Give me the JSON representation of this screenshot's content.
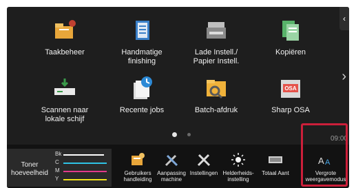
{
  "apps": [
    {
      "label": "Taakbeheer",
      "icon": "job-status-icon"
    },
    {
      "label": "Handmatige finishing",
      "icon": "manual-finishing-icon"
    },
    {
      "label": "Lade Instell./ Papier Instell.",
      "icon": "tray-settings-icon"
    },
    {
      "label": "Kopiëren",
      "icon": "copy-icon"
    },
    {
      "label": "Scannen naar lokale schijf",
      "icon": "scan-to-local-drive-icon"
    },
    {
      "label": "Recente jobs",
      "icon": "recent-jobs-icon"
    },
    {
      "label": "Batch-afdruk",
      "icon": "batch-print-icon"
    },
    {
      "label": "Sharp OSA",
      "icon": "sharp-osa-icon"
    }
  ],
  "time": "09:00",
  "toner": {
    "label": "Toner hoeveelheid",
    "channels": [
      {
        "code": "Bk",
        "color": "#ffffff",
        "level": 0.9
      },
      {
        "code": "C",
        "color": "#2ec4e6",
        "level": 0.95
      },
      {
        "code": "M",
        "color": "#e23a8a",
        "level": 0.95
      },
      {
        "code": "Y",
        "color": "#f2e21b",
        "level": 0.95
      }
    ]
  },
  "bottom": [
    {
      "label": "Gebruikers handleiding",
      "icon": "manual-icon"
    },
    {
      "label": "Aanpassing machine",
      "icon": "machine-adjust-icon"
    },
    {
      "label": "Instellingen",
      "icon": "settings-icon"
    },
    {
      "label": "Helderheids- instelling",
      "icon": "brightness-icon"
    },
    {
      "label": "Totaal Aant",
      "icon": "total-count-icon"
    },
    {
      "label": "Vergrote weergavemodus",
      "icon": "enlarged-display-icon",
      "glyph": "AA"
    }
  ],
  "colors": {
    "highlight": "#cc1f3a",
    "background": "#1e1e1e"
  }
}
